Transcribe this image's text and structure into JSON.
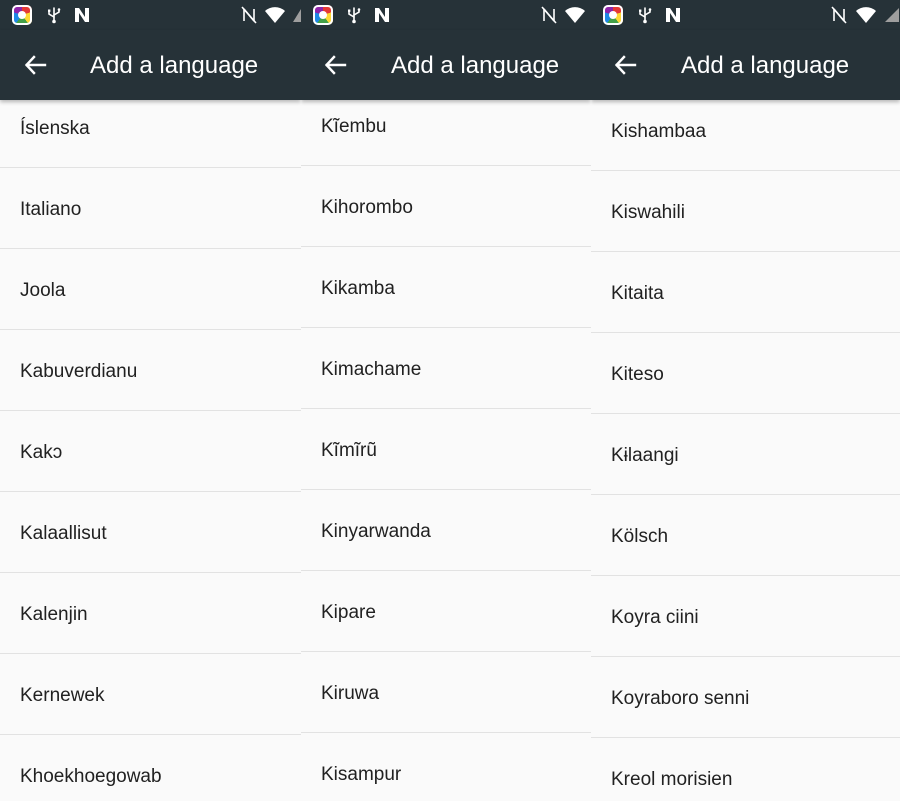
{
  "colors": {
    "app_bar": "#263238",
    "list_background": "#fafafa",
    "text": "#212121",
    "divider": "#e2e2e2",
    "title": "#ffffff"
  },
  "icons": {
    "status_left": [
      "app-icon",
      "usb-icon",
      "nfc-icon"
    ],
    "status_right": [
      "nfc-off-icon",
      "wifi-icon",
      "signal-icon"
    ],
    "app_bar": "back-arrow-icon"
  },
  "screens": [
    {
      "title": "Add a language",
      "languages": [
        "Íslenska",
        "Italiano",
        "Joola",
        "Kabuverdianu",
        "Kakɔ",
        "Kalaallisut",
        "Kalenjin",
        "Kernewek",
        "Khoekhoegowab"
      ]
    },
    {
      "title": "Add a language",
      "languages": [
        "Kĩembu",
        "Kihorombo",
        "Kikamba",
        "Kimachame",
        "Kĩmĩrũ",
        "Kinyarwanda",
        "Kipare",
        "Kiruwa",
        "Kisampur"
      ]
    },
    {
      "title": "Add a language",
      "languages": [
        "Kishambaa",
        "Kiswahili",
        "Kitaita",
        "Kiteso",
        "Kɨlaangi",
        "Kölsch",
        "Koyra ciini",
        "Koyraboro senni",
        "Kreol morisien"
      ]
    }
  ]
}
